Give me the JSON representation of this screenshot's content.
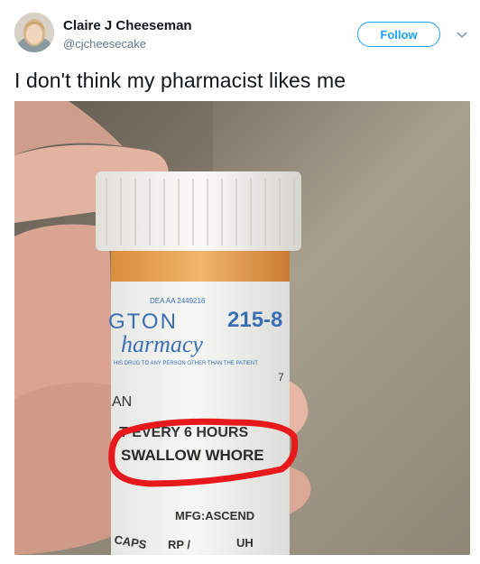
{
  "author": {
    "name": "Claire J Cheeseman",
    "handle": "@cjcheesecake",
    "avatar_icon": "avatar-photo"
  },
  "follow_label": "Follow",
  "caret_icon": "chevron-down-icon",
  "tweet_text": "I don't think my pharmacist likes me",
  "photo": {
    "label_texts": [
      "DEA AA 2449216",
      "215-8",
      "GTON",
      "harmacy",
      "HIS DRUG TO ANY PERSON OTHER THAN THE PATIENT",
      "7",
      "AN",
      "T EVERY 6 HOURS",
      "SWALLOW WHORE",
      "MFG:ASCEND",
      "CAPS",
      "RP /",
      "UH"
    ],
    "colors": {
      "highlight": "#e8191d",
      "cap": "#f4f3ef",
      "amber": "#e8a052",
      "label_blue": "#3a6fb4"
    }
  }
}
